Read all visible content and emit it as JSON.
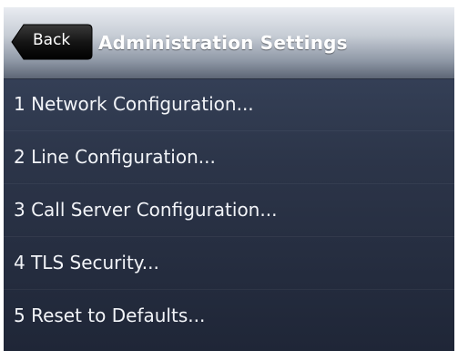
{
  "header": {
    "back_label": "Back",
    "title": "Administration Settings"
  },
  "menu": {
    "items": [
      {
        "label": "1 Network Configuration..."
      },
      {
        "label": "2 Line Configuration..."
      },
      {
        "label": "3 Call Server Configuration..."
      },
      {
        "label": "4 TLS Security..."
      },
      {
        "label": "5 Reset to Defaults..."
      }
    ]
  },
  "colors": {
    "header_top": "#e9ecf1",
    "header_bottom": "#5d6675",
    "background": "#2c3549",
    "back_button": "#111111",
    "text": "#f2f4f8"
  }
}
